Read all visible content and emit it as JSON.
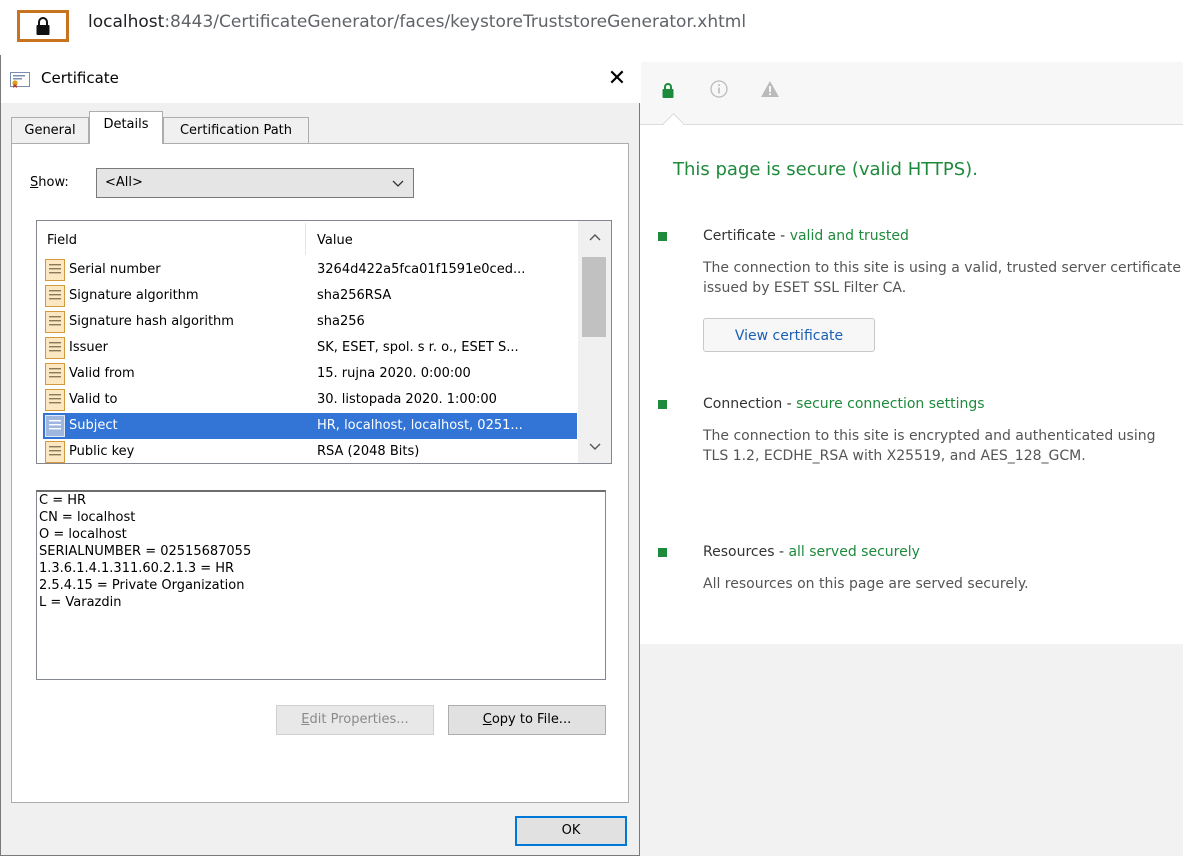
{
  "address_bar": {
    "url_host": "localhost",
    "url_rest": ":8443/CertificateGenerator/faces/keystoreTruststoreGenerator.xhtml"
  },
  "dialog": {
    "title": "Certificate",
    "close_glyph": "✕",
    "tabs": [
      {
        "label": "General"
      },
      {
        "label": "Details"
      },
      {
        "label": "Certification Path"
      }
    ],
    "show": {
      "label_underlined": "S",
      "label_rest": "how:",
      "value": "<All>"
    },
    "columns": {
      "field": "Field",
      "value": "Value"
    },
    "rows": [
      {
        "field": "Serial number",
        "value": "3264d422a5fca01f1591e0ced..."
      },
      {
        "field": "Signature algorithm",
        "value": "sha256RSA"
      },
      {
        "field": "Signature hash algorithm",
        "value": "sha256"
      },
      {
        "field": "Issuer",
        "value": "SK, ESET, spol. s r. o., ESET S..."
      },
      {
        "field": "Valid from",
        "value": "15. rujna 2020. 0:00:00"
      },
      {
        "field": "Valid to",
        "value": "30. listopada 2020. 1:00:00"
      },
      {
        "field": "Subject",
        "value": "HR, localhost, localhost, 0251..."
      },
      {
        "field": "Public key",
        "value": "RSA (2048 Bits)"
      }
    ],
    "selected_row": "Subject",
    "detail_lines": [
      "C = HR",
      "CN = localhost",
      "O = localhost",
      "SERIALNUMBER = 02515687055",
      "1.3.6.1.4.1.311.60.2.1.3 = HR",
      "2.5.4.15 = Private Organization",
      "L = Varazdin"
    ],
    "edit_properties": {
      "underlined": "E",
      "rest": "dit Properties..."
    },
    "copy_to_file": {
      "underlined": "C",
      "rest": "opy to File..."
    },
    "ok_label": "OK"
  },
  "security_panel": {
    "title": "This page is secure (valid HTTPS).",
    "accent_color": "#1e8a3c",
    "items": [
      {
        "name": "Certificate",
        "sep": " - ",
        "status": "valid and trusted",
        "description": "The connection to this site is using a valid, trusted server certificate issued by ESET SSL Filter CA.",
        "button": "View certificate"
      },
      {
        "name": "Connection",
        "sep": " - ",
        "status": "secure connection settings",
        "description": "The connection to this site is encrypted and authenticated using TLS 1.2, ECDHE_RSA with X25519, and AES_128_GCM."
      },
      {
        "name": "Resources",
        "sep": " - ",
        "status": "all served securely",
        "description": "All resources on this page are served securely."
      }
    ]
  }
}
